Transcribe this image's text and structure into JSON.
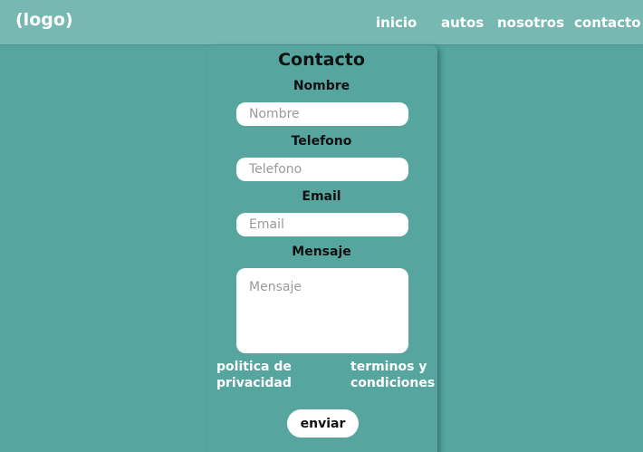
{
  "header": {
    "logo": "(logo)",
    "nav": {
      "inicio": "inicio",
      "autos": "autos",
      "nosotros": "nosotros",
      "contacto": "contacto"
    }
  },
  "form": {
    "title": "Contacto",
    "nombre": {
      "label": "Nombre",
      "placeholder": "Nombre",
      "value": ""
    },
    "telefono": {
      "label": "Telefono",
      "placeholder": "Telefono",
      "value": ""
    },
    "email": {
      "label": "Email",
      "placeholder": "Email",
      "value": ""
    },
    "mensaje": {
      "label": "Mensaje",
      "placeholder": "Mensaje",
      "value": ""
    },
    "privacy_link": "politica de privacidad",
    "terms_link": "terminos y condiciones",
    "submit_label": "enviar"
  },
  "colors": {
    "background": "#56a59e",
    "header": "#78b8b2",
    "field": "#ffffff",
    "link_text": "#ffffff"
  }
}
